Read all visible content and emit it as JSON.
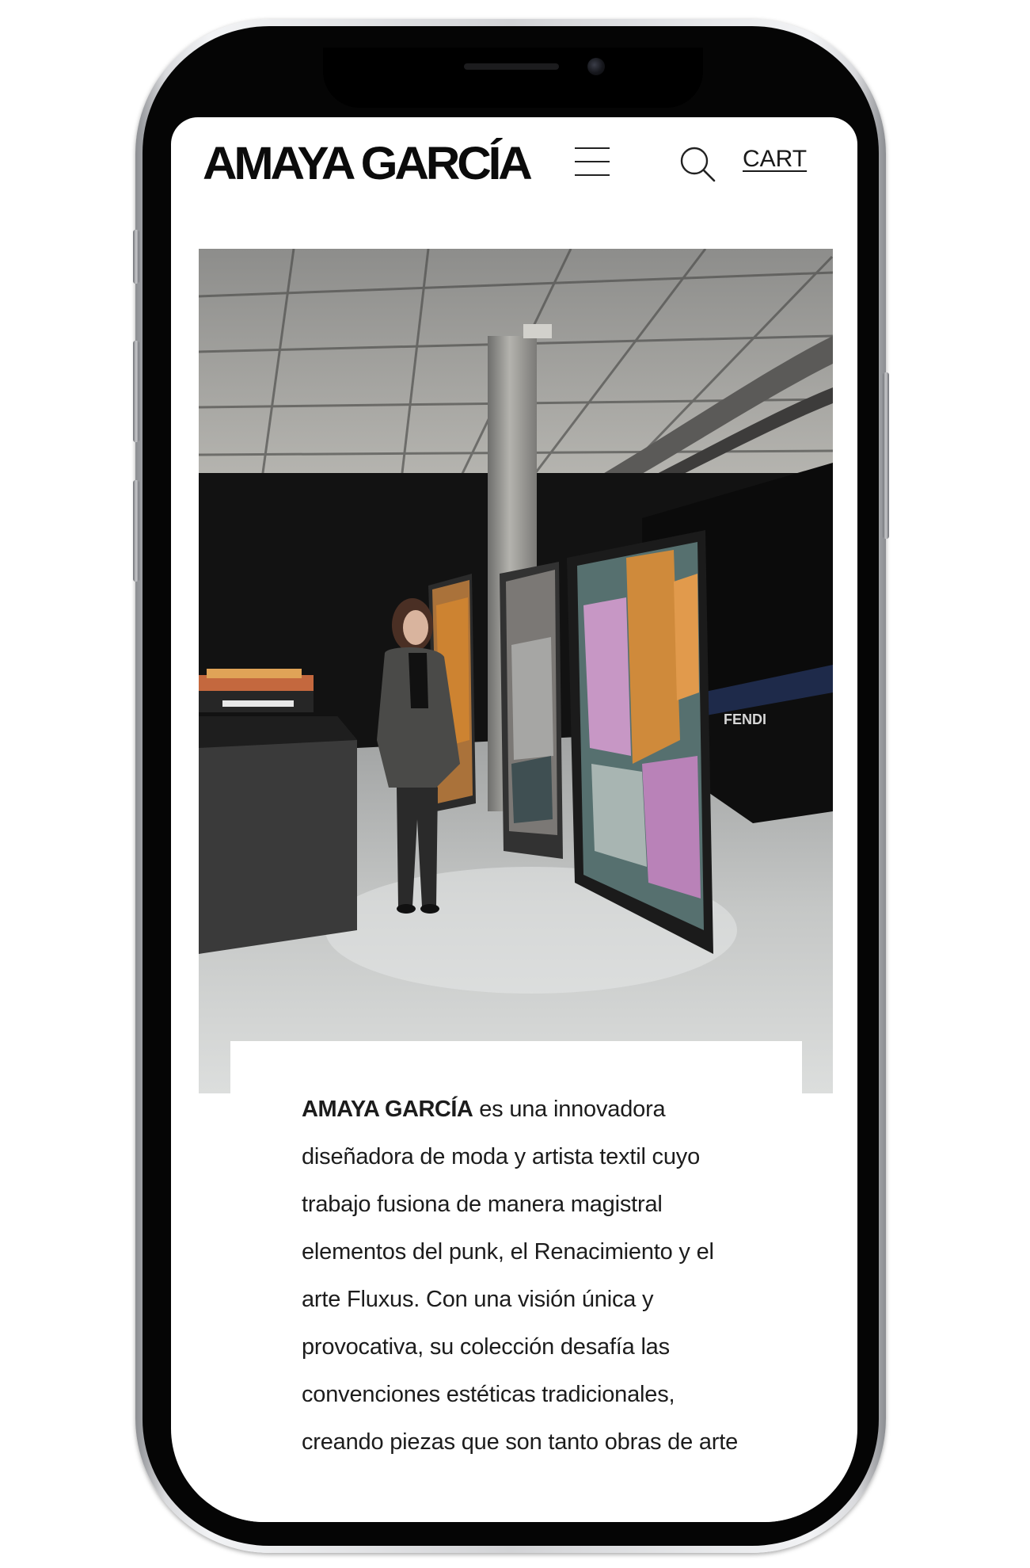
{
  "header": {
    "brand": "AMAYA GARCÍA",
    "menu_icon": "hamburger-menu-icon",
    "search_icon": "search-icon",
    "cart_label": "CART"
  },
  "hero": {
    "image": "exhibition-photo",
    "panel_brand": "FENDI"
  },
  "bio": {
    "lead": "AMAYA GARCÍA",
    "text": " es una innovadora diseñadora de moda y artista textil cuyo trabajo fusiona de manera magistral elementos del punk, el Renacimiento y el arte Fluxus. Con una visión única y provocativa, su colección desafía las convenciones estéticas tradicionales, creando piezas que son tanto obras de arte"
  },
  "colors": {
    "text": "#1c1c1c",
    "background": "#ffffff",
    "phone_bezel": "#050505"
  }
}
